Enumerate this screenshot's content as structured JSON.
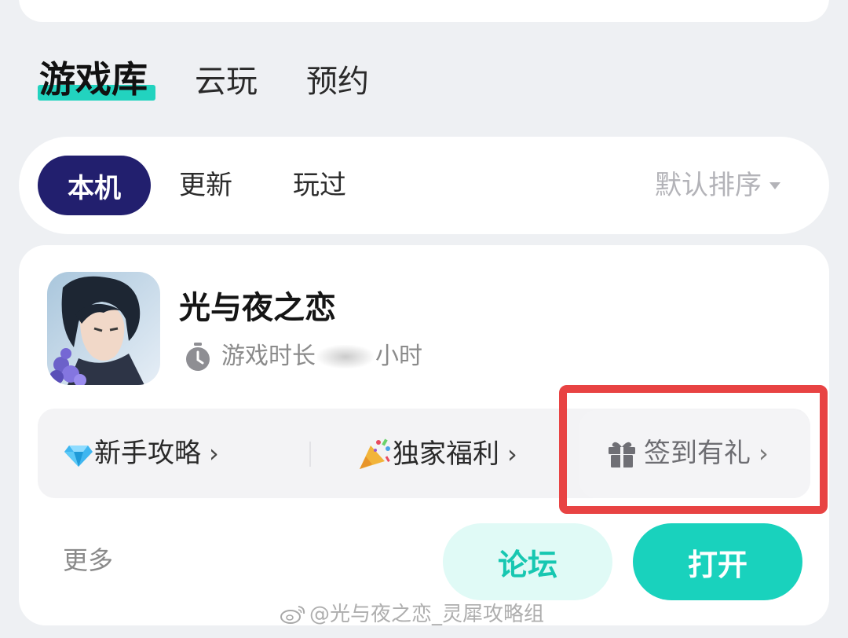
{
  "tabs": {
    "main": [
      {
        "label": "游戏库",
        "active": true
      },
      {
        "label": "云玩",
        "active": false
      },
      {
        "label": "预约",
        "active": false
      }
    ]
  },
  "filters": {
    "chips": [
      {
        "label": "本机",
        "active": true
      },
      {
        "label": "更新",
        "active": false
      },
      {
        "label": "玩过",
        "active": false
      }
    ],
    "sort_label": "默认排序"
  },
  "game": {
    "title": "光与夜之恋",
    "playtime_prefix": "游戏时长",
    "playtime_suffix": "小时",
    "features": {
      "guide": "新手攻略",
      "welfare": "独家福利",
      "checkin": "签到有礼"
    },
    "more_label": "更多",
    "forum_label": "论坛",
    "open_label": "打开"
  },
  "watermark": {
    "text": "@光与夜之恋_灵犀攻略组"
  },
  "icons": {
    "timer": "stopwatch-icon",
    "guide": "gem-icon",
    "welfare": "party-popper-icon",
    "checkin": "gift-icon"
  },
  "colors": {
    "accent": "#19d2bd",
    "active_chip": "#221f6e",
    "highlight": "#e84343"
  }
}
